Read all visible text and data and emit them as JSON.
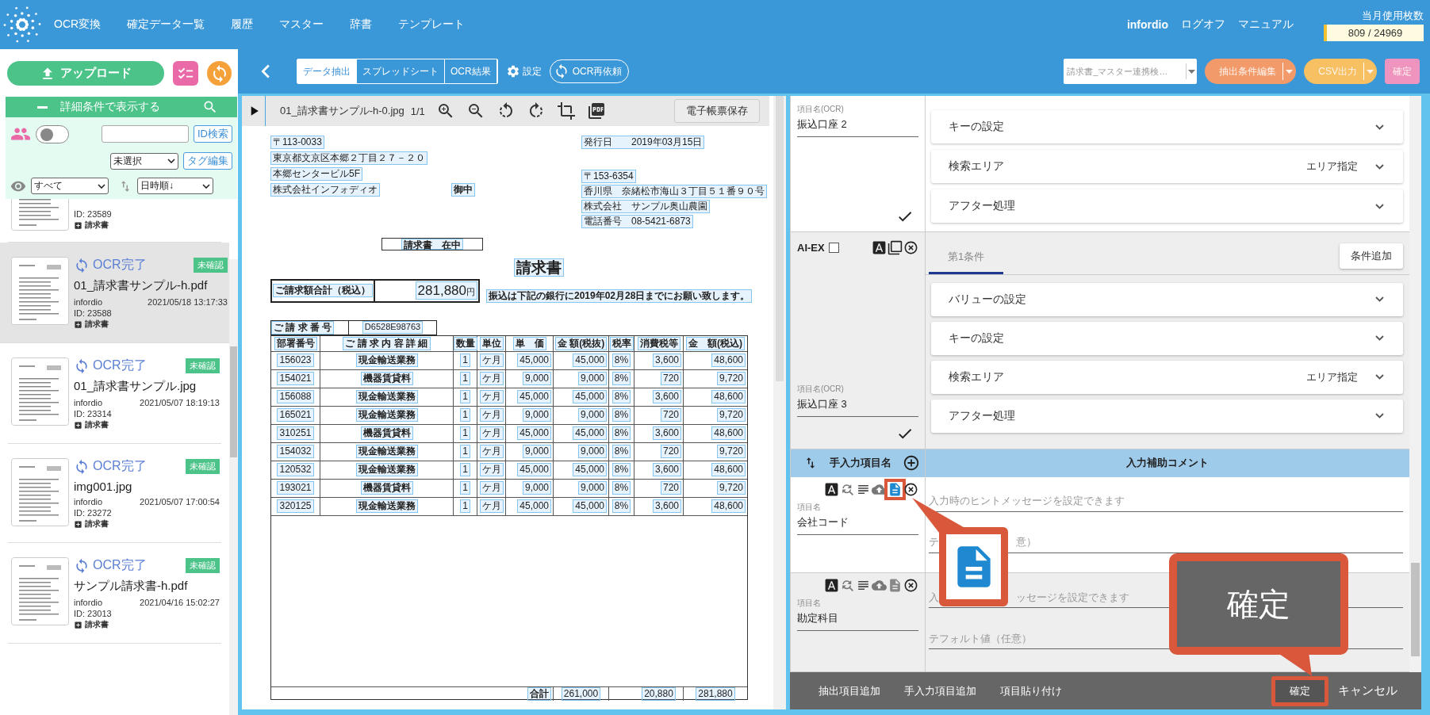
{
  "nav": {
    "menu": [
      "OCR変換",
      "確定データ一覧",
      "履歴",
      "マスター",
      "辞書",
      "テンプレート"
    ],
    "user": "infordio",
    "links": [
      "ログオフ",
      "マニュアル"
    ],
    "usage_label": "当月使用枚数",
    "usage_value": "809 / 24969"
  },
  "sidebar": {
    "upload": "アップロード",
    "filter_title": "詳細条件で表示する",
    "filter_expanded": true,
    "toggle_on": false,
    "id_button": "ID検索",
    "tag_select": "未選択",
    "tag_button": "タグ編集",
    "view_select": "すべて",
    "sort_select": "日時順↓",
    "documents": [
      {
        "id": "ID: 23589",
        "tag": "請求書",
        "selected": false
      },
      {
        "status": "OCR完了",
        "badge": "未確認",
        "name": "01_請求書サンプル-h.pdf",
        "user": "infordio",
        "date": "2021/05/18 13:17:33",
        "id": "ID: 23588",
        "tag": "請求書",
        "selected": true
      },
      {
        "status": "OCR完了",
        "badge": "未確認",
        "name": "01_請求書サンプル.jpg",
        "user": "infordio",
        "date": "2021/05/07 18:19:13",
        "id": "ID: 23314",
        "tag": "請求書",
        "selected": false
      },
      {
        "status": "OCR完了",
        "badge": "未確認",
        "name": "img001.jpg",
        "user": "infordio",
        "date": "2021/05/07 17:00:54",
        "id": "ID: 23272",
        "tag": "請求書",
        "selected": false
      },
      {
        "status": "OCR完了",
        "badge": "未確認",
        "name": "サンプル請求書-h.pdf",
        "user": "infordio",
        "date": "2021/04/16 15:02:27",
        "id": "ID: 23013",
        "tag": "請求書",
        "selected": false
      }
    ]
  },
  "toolbar": {
    "tabs": [
      {
        "label": "データ抽出",
        "selected": true
      },
      {
        "label": "スプレッドシート",
        "selected": false
      },
      {
        "label": "OCR結果",
        "selected": false
      }
    ],
    "settings": "設定",
    "rerun": "OCR再依頼",
    "template_select": "請求書_マスター連携検…",
    "buttons": [
      {
        "label": "抽出条件編集",
        "kind": "split",
        "color": "#f29a6a",
        "disabled": true
      },
      {
        "label": "CSV出力",
        "kind": "split",
        "color": "#f7c062",
        "disabled": true
      },
      {
        "label": "確定",
        "kind": "plain",
        "color": "#ef93bf",
        "disabled": true
      }
    ]
  },
  "viewer": {
    "file": "01_請求書サンプル-h-0.jpg",
    "page": "1/1",
    "save_button": "電子帳票保存",
    "invoice": {
      "to_lines": [
        "〒113-0033",
        "東京都文京区本郷２丁目２７－２０",
        "本郷センタービル5F",
        "株式会社インフォディオ"
      ],
      "honorific": "御中",
      "date_label": "発行日",
      "date": "2019年03月15日",
      "from_lines": [
        "〒153-6354",
        "香川県　奈緒松市海山３丁目５１番９０号",
        "株式会社　サンプル奥山農園",
        "電話番号　08-5421-6873"
      ],
      "envelope": "請求書　在中",
      "title": "請求書",
      "total_label": "ご請求額合計（税込）",
      "total": "281,880",
      "yen": "円",
      "notice": "振込は下記の銀行に2019年02月28日までにお願い致します。",
      "number_label": "ご 請 求 番 号",
      "number": "D6528E98763",
      "columns": [
        "部署番号",
        "ご 請 求 内 容 詳 細",
        "数量",
        "単位",
        "単　価",
        "金 額(税抜)",
        "税率",
        "消費税等",
        "金　額(税込)"
      ],
      "rows": [
        [
          "156023",
          "現金輸送業務",
          "1",
          "ケ月",
          "45,000",
          "45,000",
          "8%",
          "3,600",
          "48,600"
        ],
        [
          "154021",
          "機器賃貸料",
          "1",
          "ケ月",
          "9,000",
          "9,000",
          "8%",
          "720",
          "9,720"
        ],
        [
          "156088",
          "現金輸送業務",
          "1",
          "ケ月",
          "45,000",
          "45,000",
          "8%",
          "3,600",
          "48,600"
        ],
        [
          "165021",
          "現金輸送業務",
          "1",
          "ケ月",
          "9,000",
          "9,000",
          "8%",
          "720",
          "9,720"
        ],
        [
          "310251",
          "機器賃貸料",
          "1",
          "ケ月",
          "45,000",
          "45,000",
          "8%",
          "3,600",
          "48,600"
        ],
        [
          "154032",
          "現金輸送業務",
          "1",
          "ケ月",
          "9,000",
          "9,000",
          "8%",
          "720",
          "9,720"
        ],
        [
          "120532",
          "現金輸送業務",
          "1",
          "ケ月",
          "45,000",
          "45,000",
          "8%",
          "3,600",
          "48,600"
        ],
        [
          "193021",
          "機器賃貸料",
          "1",
          "ケ月",
          "9,000",
          "9,000",
          "8%",
          "720",
          "9,720"
        ],
        [
          "320125",
          "現金輸送業務",
          "1",
          "ケ月",
          "45,000",
          "45,000",
          "8%",
          "3,600",
          "48,600"
        ]
      ],
      "totals_label": "合計",
      "totals": [
        "261,000",
        "20,880",
        "281,880"
      ]
    }
  },
  "editor": {
    "blocks": [
      {
        "kind": "ocr",
        "field_label": "項目名(OCR)",
        "field_value": "振込口座 2",
        "confirmed": true,
        "cards": [
          {
            "label": "キーの設定"
          },
          {
            "label": "検索エリア",
            "value": "エリア指定"
          },
          {
            "label": "アフター処理"
          }
        ]
      },
      {
        "kind": "ai",
        "ai_label": "AI-EX",
        "ai_checked": false,
        "field_label": "項目名(OCR)",
        "field_value": "振込口座 3",
        "confirmed": true,
        "tabs": [
          {
            "label": "第1条件",
            "selected": true
          }
        ],
        "add_button": "条件追加",
        "cards": [
          {
            "label": "バリューの設定"
          },
          {
            "label": "キーの設定"
          },
          {
            "label": "検索エリア",
            "value": "エリア指定"
          },
          {
            "label": "アフター処理"
          }
        ]
      }
    ],
    "manual_header": {
      "name": "手入力項目名",
      "comment": "入力補助コメント"
    },
    "manual_items": [
      {
        "label": "項目名",
        "value": "会社コード",
        "hint_placeholder": [
          "入力時のヒントメッセージを設定できます"
        ],
        "default_placeholder": [
          "テ",
          "意）"
        ],
        "doc_active": true,
        "highlighted": true
      },
      {
        "label": "項目名",
        "value": "勘定科目",
        "hint_placeholder": [
          "入",
          "ッセージを設定できます"
        ],
        "default_placeholder": [
          "テフォルト値（任意）"
        ],
        "doc_active": false,
        "highlighted": false
      }
    ],
    "footer": {
      "actions": [
        "抽出項目追加",
        "手入力項目追加",
        "項目貼り付け"
      ],
      "confirm": "確定",
      "confirm_highlighted": true,
      "cancel": "キャンセル"
    }
  },
  "callouts": [
    {
      "kind": "icon"
    },
    {
      "kind": "text",
      "text": "確定"
    }
  ]
}
